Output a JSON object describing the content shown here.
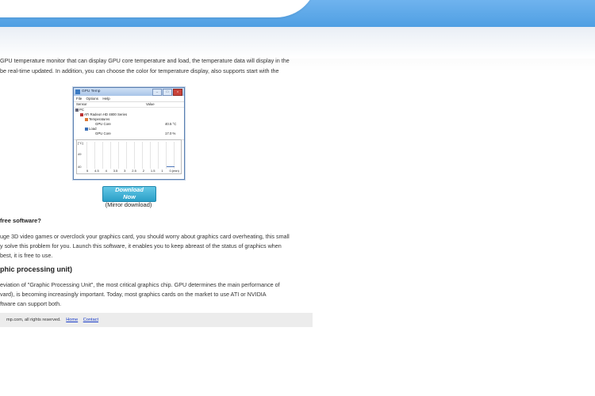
{
  "intro": {
    "line1": "GPU temperature monitor that can display GPU core temperature and load, the temperature data will display in the",
    "line2": "be real-time updated. In addition, you can choose the color for temperature display, also supports start with the"
  },
  "app_window": {
    "title": "GPU Temp",
    "menu": [
      "File",
      "Options",
      "Help"
    ],
    "columns": [
      "Sensor",
      "Value"
    ],
    "tree": [
      {
        "label": "PC",
        "value": ""
      },
      {
        "label": "ATI Radeon HD 4800 Series",
        "value": ""
      },
      {
        "label": "Temperatures",
        "value": ""
      },
      {
        "label": "GPU Core",
        "value": "40.5 °C"
      },
      {
        "label": "Load",
        "value": ""
      },
      {
        "label": "GPU Core",
        "value": "17.0 %"
      }
    ],
    "graph": {
      "unit": "[°C]",
      "y_ticks": [
        "49",
        "40"
      ],
      "x_ticks": [
        "5",
        "4.5",
        "4",
        "3.5",
        "3",
        "2.5",
        "2",
        "1.5",
        "1",
        "0.(min)"
      ]
    }
  },
  "download": {
    "button_line1": "Download",
    "button_line2": "Now",
    "mirror": "(Mirror download)"
  },
  "section1": {
    "heading": "free software?",
    "line1": "uge 3D video games or overclock your graphics card, you should worry about graphics card overheating, this small",
    "line2": "y solve this problem for you. Launch this software, it enables you to keep abreast of the status of graphics when",
    "line3": "best, it is free to use."
  },
  "section2": {
    "heading": "phic processing unit)",
    "line1": "eviation of \"Graphic Processing Unit\", the most critical graphics chip. GPU determines the main performance of",
    "line2": "vard), is becoming increasingly important. Today, most graphics cards on the market to use ATI or NVIDIA",
    "line3": "ftware can support both."
  },
  "footer": {
    "copyright": "mp.com, all rights reserved.",
    "home": "Home",
    "contact": "Contact"
  },
  "colors": {
    "banner_blue": "#4f9fe3",
    "button": "#2a9fc7",
    "link": "#1a3cc8"
  }
}
